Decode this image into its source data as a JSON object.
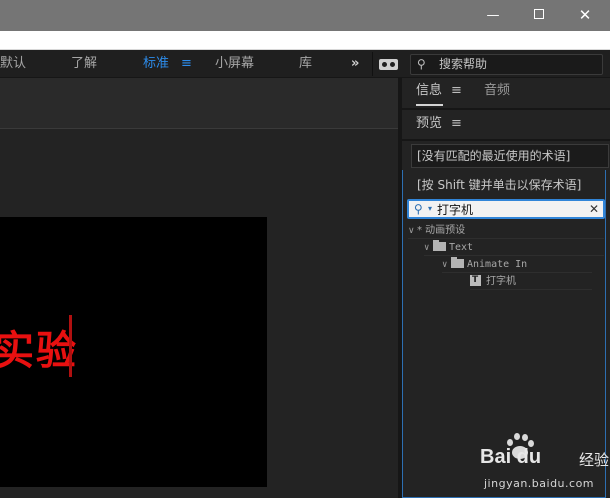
{
  "toolbar": {
    "workspaces": [
      "默认",
      "了解",
      "标准",
      "小屏幕",
      "库"
    ],
    "active_workspace": "标准",
    "menu_glyph": "≡",
    "overflow_glyph": "»",
    "help_search_placeholder": "搜索帮助"
  },
  "window": {
    "minimize_glyph": "—",
    "close_glyph": "✕"
  },
  "composition": {
    "canvas_text": "实验"
  },
  "right_panel": {
    "tabs": [
      "信息",
      "音频"
    ],
    "active_tab": "信息",
    "preview_label": "预览",
    "menu_glyph": "≡",
    "term_dropdown": "[没有匹配的最近使用的术语]",
    "term_hint": "[按 Shift 键并单击以保存术语]",
    "search_value": "打字机",
    "clear_glyph": "✕",
    "tree": [
      {
        "label": "* 动画预设",
        "level": 0,
        "kind": "root"
      },
      {
        "label": "Text",
        "level": 1,
        "kind": "folder"
      },
      {
        "label": "Animate In",
        "level": 2,
        "kind": "folder"
      },
      {
        "label": "打字机",
        "level": 3,
        "kind": "preset"
      }
    ]
  },
  "watermark": {
    "brand": "Bai  du",
    "sub": "经验",
    "url": "jingyan.baidu.com"
  },
  "colors": {
    "accent": "#2d8ceb",
    "canvas_text": "#e81010",
    "panel_bg": "#232323"
  }
}
